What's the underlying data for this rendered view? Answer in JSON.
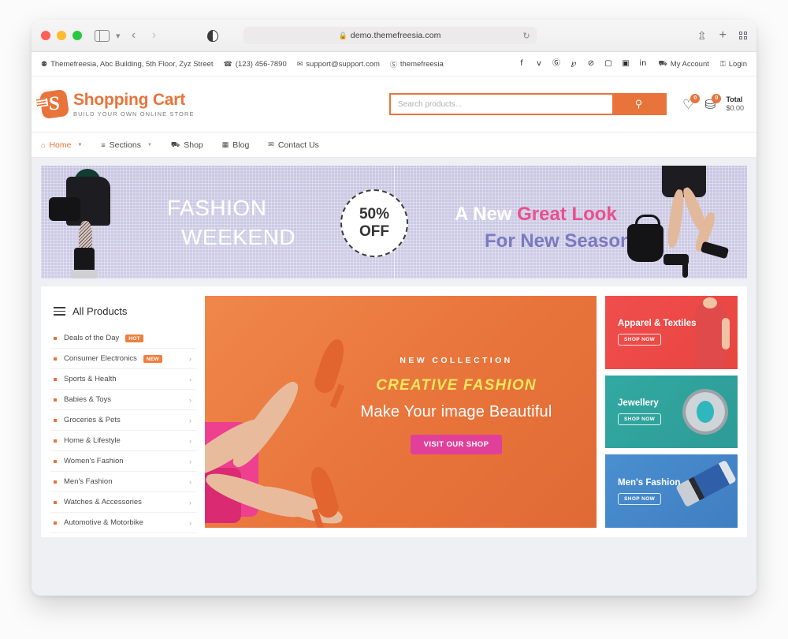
{
  "browser": {
    "url": "demo.themefreesia.com",
    "lock_icon": "lock-icon",
    "reload_icon": "reload-icon",
    "back_icon": "back-arrow-icon",
    "forward_icon": "forward-arrow-icon",
    "sidebar_icon": "sidebar-toggle-icon",
    "shield_icon": "privacy-shield-icon",
    "share_icon": "share-icon",
    "newtab_icon": "plus-icon",
    "tabs_icon": "tab-overview-icon"
  },
  "topbar": {
    "contacts": [
      {
        "icon": "map-pin-icon",
        "glyph": "⚉",
        "text": "Themefreesia, Abc Building, 5th Floor, Zyz Street"
      },
      {
        "icon": "phone-icon",
        "glyph": "☎",
        "text": "(123) 456-7890"
      },
      {
        "icon": "envelope-icon",
        "glyph": "✉",
        "text": "support@support.com"
      },
      {
        "icon": "skype-icon",
        "glyph": "Ⓢ",
        "text": "themefreesia"
      }
    ],
    "social": [
      {
        "name": "facebook-icon",
        "glyph": "f"
      },
      {
        "name": "twitter-icon",
        "glyph": "ᴠ"
      },
      {
        "name": "google-plus-icon",
        "glyph": "Ⓖ"
      },
      {
        "name": "pinterest-icon",
        "glyph": "℘"
      },
      {
        "name": "dribbble-icon",
        "glyph": "⊘"
      },
      {
        "name": "instagram-icon",
        "glyph": "▢"
      },
      {
        "name": "flickr-icon",
        "glyph": "▣"
      },
      {
        "name": "linkedin-icon",
        "glyph": "in"
      }
    ],
    "account": {
      "label": "My Account",
      "glyph": "⛟"
    },
    "login": {
      "label": "Login",
      "glyph": "⚿"
    }
  },
  "brand": {
    "letter": "S",
    "title": "Shopping Cart",
    "tagline": "BUILD YOUR OWN ONLINE STORE",
    "color": "#e8743b"
  },
  "search": {
    "placeholder": "Search products...",
    "value": "",
    "button_icon": "search-icon",
    "button_glyph": "⚲"
  },
  "header_actions": {
    "wishlist": {
      "icon": "heart-icon",
      "glyph": "♡",
      "count": "0"
    },
    "cart": {
      "icon": "basket-icon",
      "glyph": "⛁",
      "count": "0"
    },
    "total_label": "Total",
    "total_value": "$0.00"
  },
  "nav": {
    "items": [
      {
        "label": "Home",
        "glyph": "⌂",
        "icon": "home-icon",
        "active": true,
        "caret": "▼"
      },
      {
        "label": "Sections",
        "glyph": "≡",
        "icon": "sections-icon",
        "active": false,
        "caret": "▼"
      },
      {
        "label": "Shop",
        "glyph": "⛟",
        "icon": "shop-cart-icon",
        "active": false,
        "caret": ""
      },
      {
        "label": "Blog",
        "glyph": "▦",
        "icon": "blog-grid-icon",
        "active": false,
        "caret": ""
      },
      {
        "label": "Contact Us",
        "glyph": "✉",
        "icon": "contact-envelope-icon",
        "active": false,
        "caret": ""
      }
    ]
  },
  "hero": {
    "left_line1": "FASHION",
    "left_line2": "WEEKEND",
    "discount_pct": "50%",
    "discount_off": "OFF",
    "right_line1_a": "A New ",
    "right_line1_b": "Great Look",
    "right_line2": "For New Season",
    "colors": {
      "background": "#cbc8e4",
      "pink": "#e8508c",
      "purple": "#7b79c0"
    }
  },
  "sidebar": {
    "title": "All Products",
    "menu_icon": "hamburger-icon",
    "categories": [
      {
        "label": "Deals of the Day",
        "tag": "HOT",
        "arrow": ""
      },
      {
        "label": "Consumer Electronics",
        "tag": "NEW",
        "arrow": "›"
      },
      {
        "label": "Sports & Health",
        "tag": "",
        "arrow": "›"
      },
      {
        "label": "Babies & Toys",
        "tag": "",
        "arrow": "›"
      },
      {
        "label": "Groceries & Pets",
        "tag": "",
        "arrow": "›"
      },
      {
        "label": "Home & Lifestyle",
        "tag": "",
        "arrow": "›"
      },
      {
        "label": "Women's Fashion",
        "tag": "",
        "arrow": "›"
      },
      {
        "label": "Men's Fashion",
        "tag": "",
        "arrow": "›"
      },
      {
        "label": "Watches & Accessories",
        "tag": "",
        "arrow": "›"
      },
      {
        "label": "Automotive & Motorbike",
        "tag": "",
        "arrow": "›"
      }
    ]
  },
  "promo": {
    "eyebrow": "NEW COLLECTION",
    "headline": "CREATIVE FASHION",
    "subline": "Make Your image Beautiful",
    "cta": "VISIT OUR SHOP",
    "colors": {
      "background": "#e8743b",
      "eyebrow_highlight": "#4d0b6b",
      "headline": "#f5e85c",
      "cta": "#e0409a"
    }
  },
  "cards": [
    {
      "title": "Apparel & Textiles",
      "cta": "SHOP NOW",
      "color": "#ec4a46"
    },
    {
      "title": "Jewellery",
      "cta": "SHOP NOW",
      "color": "#2fa29d"
    },
    {
      "title": "Men's Fashion",
      "cta": "SHOP NOW",
      "color": "#4486c9"
    }
  ]
}
